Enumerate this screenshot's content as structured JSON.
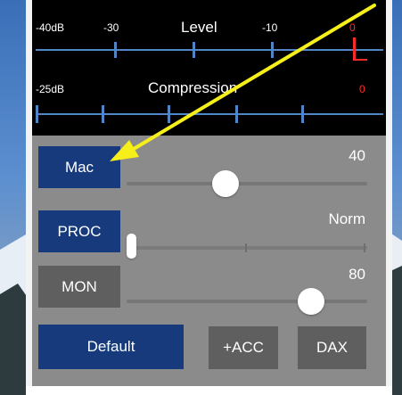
{
  "meter": {
    "level": {
      "title": "Level",
      "ticks": [
        "-40dB",
        "-30",
        "-10",
        "0"
      ],
      "peak_mark_color": "#ff2a2a"
    },
    "compression": {
      "title": "Compression",
      "ticks": [
        "-25dB",
        "0"
      ],
      "peak_mark_color": "#ff2a2a"
    }
  },
  "controls": {
    "mac": {
      "label": "Mac",
      "value": "40",
      "level_fraction": 0.4
    },
    "proc": {
      "label": "PROC",
      "value": "Norm",
      "level_fraction": 0.0
    },
    "mon": {
      "label": "MON",
      "value": "80",
      "level_fraction": 0.8
    }
  },
  "buttons": {
    "default": "Default",
    "acc": "+ACC",
    "dax": "DAX"
  },
  "colors": {
    "accent_blue": "#163a7c",
    "meter_blue": "#4f86c6",
    "annotation_yellow": "#f6ef19"
  }
}
